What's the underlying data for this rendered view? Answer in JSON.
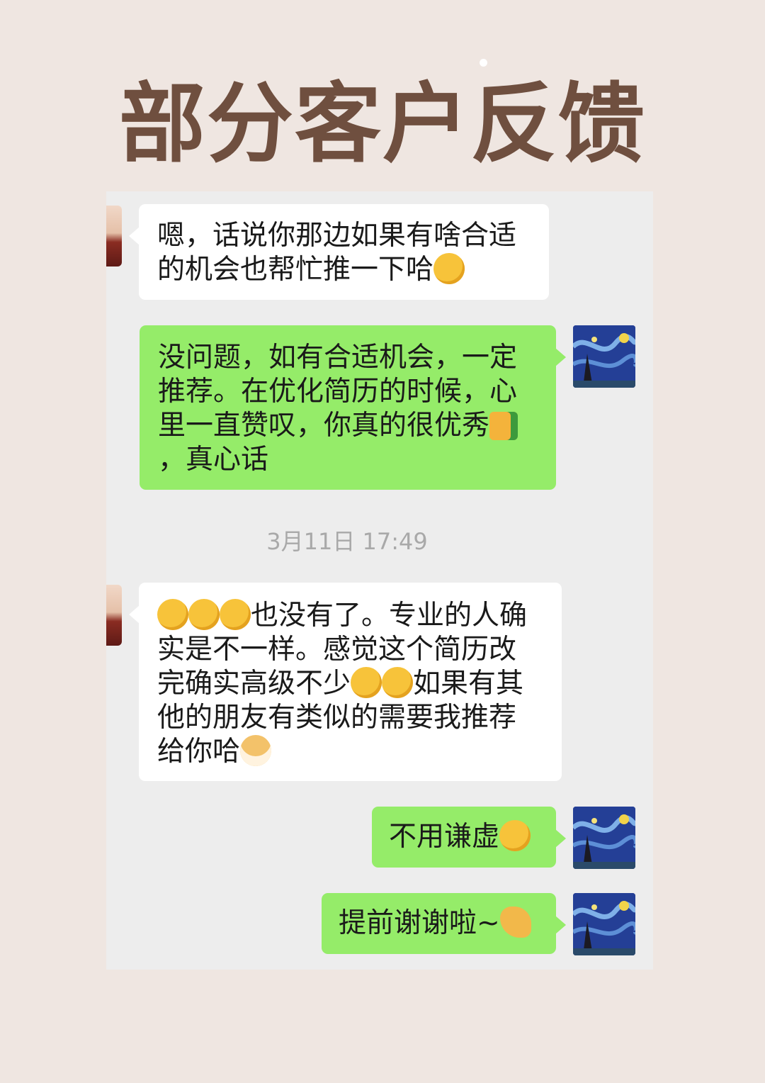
{
  "header": {
    "title": "部分客户反馈"
  },
  "chat": {
    "messages": [
      {
        "side": "in",
        "text": "嗯，话说你那边如果有啥合适的机会也帮忙推一下哈",
        "emoji": [
          "smirk-face-icon"
        ]
      },
      {
        "side": "out",
        "text": "没问题，如有合适机会，一定推荐。在优化简历的时候，心里一直赞叹，你真的很优秀",
        "emoji": [
          "thumbs-up-icon"
        ],
        "tail": "，真心话"
      },
      {
        "side": "in",
        "text_pre_emoji": [
          "facepalm-icon",
          "facepalm-icon",
          "facepalm-icon"
        ],
        "text": "也没有了。专业的人确实是不一样。感觉这个简历改完确实高级不少",
        "emoji": [
          "smirk-face-icon",
          "smirk-face-icon"
        ],
        "tail": "如果有其他的朋友有类似的需要我推荐给你哈",
        "end_emoji": [
          "doge-icon"
        ]
      },
      {
        "side": "out",
        "text": "不用谦虚",
        "emoji": [
          "grin-face-icon"
        ]
      },
      {
        "side": "out",
        "text": "提前谢谢啦~",
        "emoji": [
          "ok-hand-icon"
        ]
      }
    ],
    "timestamp": "3月11日 17:49"
  },
  "colors": {
    "background": "#efe6e1",
    "title": "#6f4f3f",
    "chat_bg": "#ededed",
    "bubble_in": "#ffffff",
    "bubble_out": "#95ec69",
    "timestamp": "#a9a9a9"
  }
}
